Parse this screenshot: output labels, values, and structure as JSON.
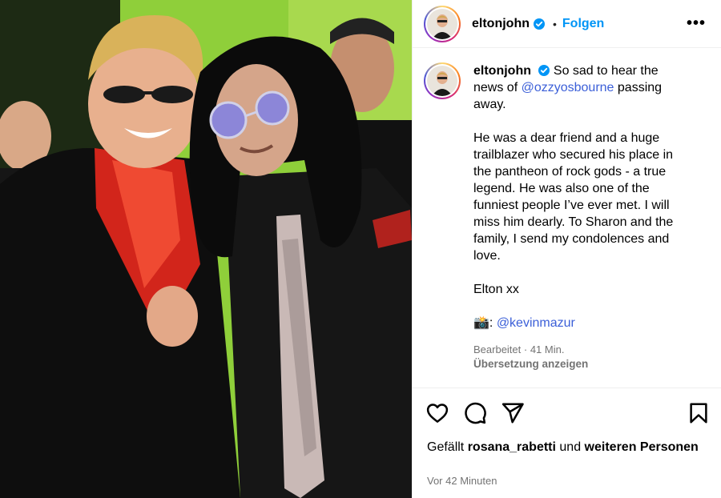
{
  "header": {
    "username": "eltonjohn",
    "separator": "•",
    "follow_label": "Folgen",
    "more_label": "•••"
  },
  "caption": {
    "username": "eltonjohn",
    "line_start": "So sad to hear the news of ",
    "mention_1": "@ozzyosbourne",
    "line_end": " passing away.",
    "paragraph_2": "He was a dear friend and a huge trailblazer who secured his place in the pantheon of rock gods - a true legend. He was also one of the funniest people I’ve ever met. I will miss him dearly. To Sharon and the family, I send my condolences and love.",
    "signoff": "Elton xx",
    "camera_prefix": "📸: ",
    "mention_2": "@kevinmazur",
    "edited_meta": "Bearbeitet · 41 Min.",
    "translate_label": "Übersetzung anzeigen"
  },
  "likes": {
    "prefix": "Gefällt ",
    "user": "rosana_rabetti",
    "middle": " und ",
    "others": "weiteren Personen"
  },
  "timestamp": "Vor 42 Minuten",
  "icons": {
    "like": "heart-icon",
    "comment": "comment-icon",
    "share": "send-icon",
    "save": "bookmark-icon",
    "verified": "verified-badge-icon",
    "more": "more-options-icon"
  },
  "colors": {
    "link": "#3b5fd8",
    "follow": "#0095f6",
    "verified": "#0095f6",
    "muted": "#737373"
  }
}
